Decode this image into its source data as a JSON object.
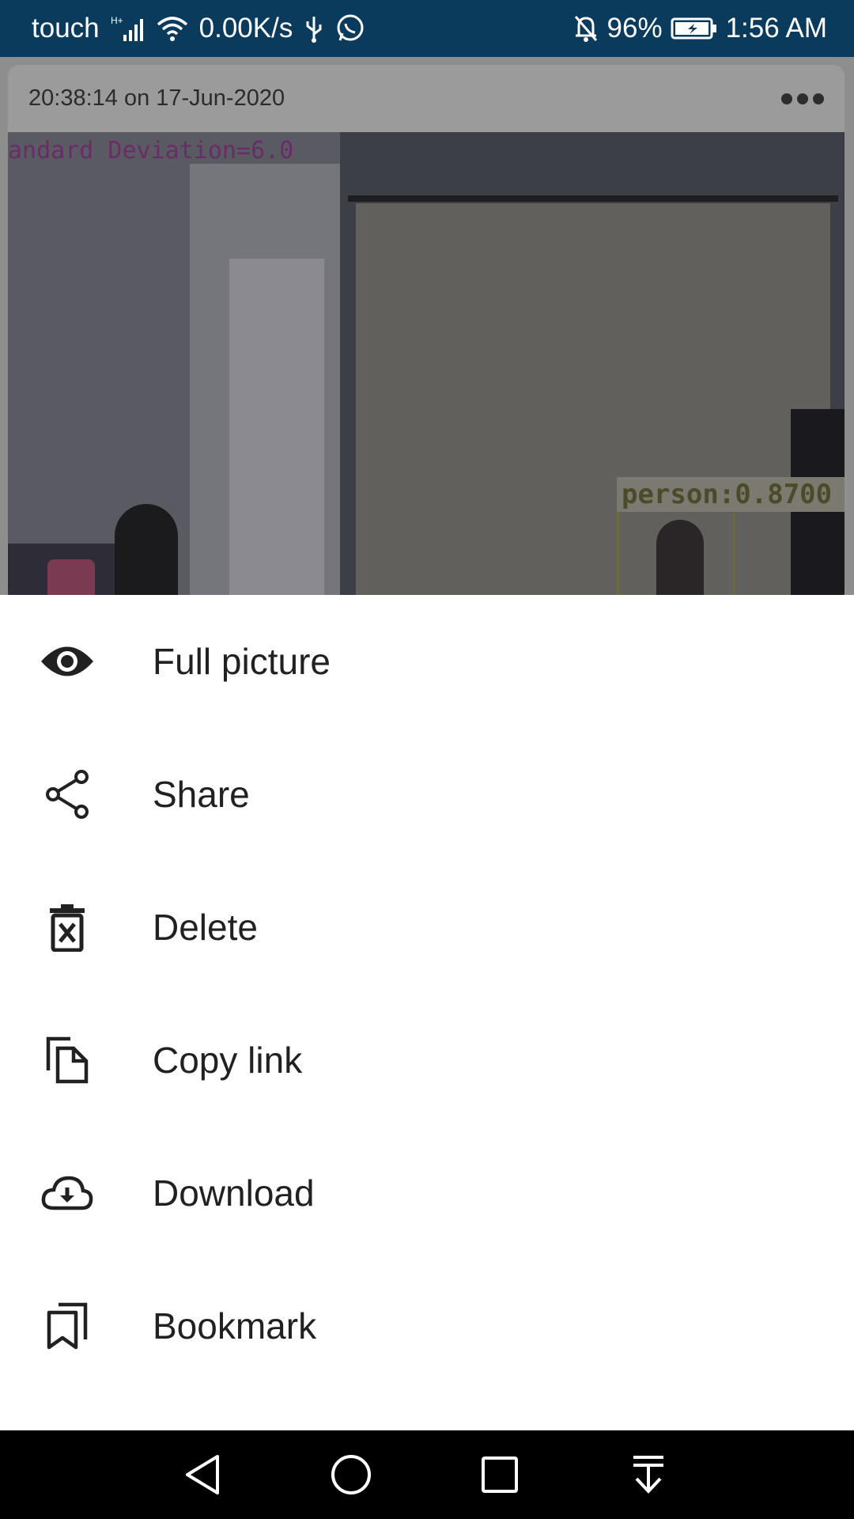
{
  "status_bar": {
    "carrier": "touch",
    "network_speed": "0.00K/s",
    "battery_percent": "96%",
    "time": "1:56 AM",
    "icons": [
      "signal-icon",
      "wifi-icon",
      "usb-icon",
      "whatsapp-icon",
      "bell-off-icon",
      "battery-charging-icon"
    ]
  },
  "card": {
    "timestamp": "20:38:14 on 17-Jun-2020",
    "photo_overlay_text": "andard Deviation=6.0",
    "detection_label": "person:0.8700"
  },
  "sheet": {
    "items": [
      {
        "label": "Full picture",
        "icon": "eye-icon"
      },
      {
        "label": "Share",
        "icon": "share-icon"
      },
      {
        "label": "Delete",
        "icon": "delete-icon"
      },
      {
        "label": "Copy link",
        "icon": "copy-icon"
      },
      {
        "label": "Download",
        "icon": "cloud-download-icon"
      },
      {
        "label": "Bookmark",
        "icon": "bookmark-icon"
      }
    ]
  },
  "navbar": {
    "buttons": [
      "back-icon",
      "home-icon",
      "recents-icon",
      "notifications-pulldown-icon"
    ]
  },
  "colors": {
    "status_bar_bg": "#0a3a5c",
    "sheet_bg": "#ffffff",
    "text_primary": "#212121",
    "nav_bg": "#000000"
  }
}
